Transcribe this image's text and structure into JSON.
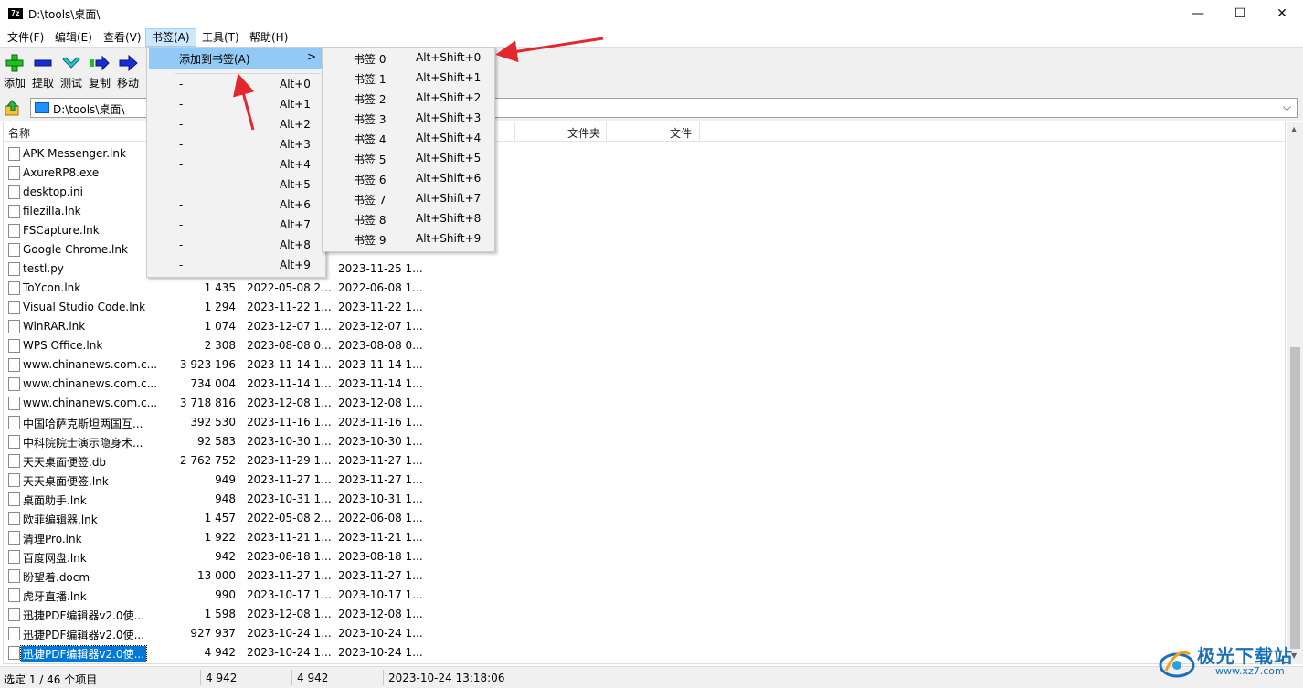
{
  "window": {
    "title": "D:\\tools\\桌面\\",
    "app_icon_text": "7z",
    "minimize": "—",
    "maximize": "☐",
    "close": "✕"
  },
  "menubar": [
    "文件(F)",
    "编辑(E)",
    "查看(V)",
    "书签(A)",
    "工具(T)",
    "帮助(H)"
  ],
  "toolbar": [
    "添加",
    "提取",
    "测试",
    "复制",
    "移动"
  ],
  "address": {
    "path": "D:\\tools\\桌面\\"
  },
  "columns": {
    "name": "名称",
    "folder": "文件夹",
    "file": "文件"
  },
  "files": [
    {
      "name": "APK Messenger.lnk",
      "size": "",
      "modified": "",
      "created": ""
    },
    {
      "name": "AxureRP8.exe",
      "size": "",
      "modified": "",
      "created": ""
    },
    {
      "name": "desktop.ini",
      "size": "",
      "modified": "",
      "created": ""
    },
    {
      "name": "filezilla.lnk",
      "size": "",
      "modified": "",
      "created": ""
    },
    {
      "name": "FSCapture.lnk",
      "size": "",
      "modified": "",
      "created": ""
    },
    {
      "name": "Google Chrome.lnk",
      "size": "",
      "modified": "",
      "created": ""
    },
    {
      "name": "testl.py",
      "size": "",
      "modified": "",
      "created": "2023-11-25 1..."
    },
    {
      "name": "ToYcon.lnk",
      "size": "1 435",
      "modified": "2022-05-08 2...",
      "created": "2022-06-08 1..."
    },
    {
      "name": "Visual Studio Code.lnk",
      "size": "1 294",
      "modified": "2023-11-22 1...",
      "created": "2023-11-22 1..."
    },
    {
      "name": "WinRAR.lnk",
      "size": "1 074",
      "modified": "2023-12-07 1...",
      "created": "2023-12-07 1..."
    },
    {
      "name": "WPS Office.lnk",
      "size": "2 308",
      "modified": "2023-08-08 0...",
      "created": "2023-08-08 0..."
    },
    {
      "name": "www.chinanews.com.c...",
      "size": "3 923 196",
      "modified": "2023-11-14 1...",
      "created": "2023-11-14 1..."
    },
    {
      "name": "www.chinanews.com.c...",
      "size": "734 004",
      "modified": "2023-11-14 1...",
      "created": "2023-11-14 1..."
    },
    {
      "name": "www.chinanews.com.c...",
      "size": "3 718 816",
      "modified": "2023-12-08 1...",
      "created": "2023-12-08 1..."
    },
    {
      "name": "中国哈萨克斯坦两国互...",
      "size": "392 530",
      "modified": "2023-11-16 1...",
      "created": "2023-11-16 1..."
    },
    {
      "name": "中科院院士演示隐身术...",
      "size": "92 583",
      "modified": "2023-10-30 1...",
      "created": "2023-10-30 1..."
    },
    {
      "name": "天天桌面便签.db",
      "size": "2 762 752",
      "modified": "2023-11-29 1...",
      "created": "2023-11-27 1..."
    },
    {
      "name": "天天桌面便签.lnk",
      "size": "949",
      "modified": "2023-11-27 1...",
      "created": "2023-11-27 1..."
    },
    {
      "name": "桌面助手.lnk",
      "size": "948",
      "modified": "2023-10-31 1...",
      "created": "2023-10-31 1..."
    },
    {
      "name": "欧菲编辑器.lnk",
      "size": "1 457",
      "modified": "2022-05-08 2...",
      "created": "2022-06-08 1..."
    },
    {
      "name": "清理Pro.lnk",
      "size": "1 922",
      "modified": "2023-11-21 1...",
      "created": "2023-11-21 1..."
    },
    {
      "name": "百度网盘.lnk",
      "size": "942",
      "modified": "2023-08-18 1...",
      "created": "2023-08-18 1..."
    },
    {
      "name": "盼望着.docm",
      "size": "13 000",
      "modified": "2023-11-27 1...",
      "created": "2023-11-27 1..."
    },
    {
      "name": "虎牙直播.lnk",
      "size": "990",
      "modified": "2023-10-17 1...",
      "created": "2023-10-17 1..."
    },
    {
      "name": "迅捷PDF编辑器v2.0使...",
      "size": "1 598",
      "modified": "2023-12-08 1...",
      "created": "2023-12-08 1..."
    },
    {
      "name": "迅捷PDF编辑器v2.0使...",
      "size": "927 937",
      "modified": "2023-10-24 1...",
      "created": "2023-10-24 1..."
    },
    {
      "name": "迅捷PDF编辑器v2.0使...",
      "size": "4 942",
      "modified": "2023-10-24 1...",
      "created": "2023-10-24 1..."
    }
  ],
  "bookmark_menu": {
    "add_label": "添加到书签(A)",
    "submenu_arrow": ">",
    "items": [
      {
        "label": "-",
        "shortcut": "Alt+0"
      },
      {
        "label": "-",
        "shortcut": "Alt+1"
      },
      {
        "label": "-",
        "shortcut": "Alt+2"
      },
      {
        "label": "-",
        "shortcut": "Alt+3"
      },
      {
        "label": "-",
        "shortcut": "Alt+4"
      },
      {
        "label": "-",
        "shortcut": "Alt+5"
      },
      {
        "label": "-",
        "shortcut": "Alt+6"
      },
      {
        "label": "-",
        "shortcut": "Alt+7"
      },
      {
        "label": "-",
        "shortcut": "Alt+8"
      },
      {
        "label": "-",
        "shortcut": "Alt+9"
      }
    ]
  },
  "add_bookmark_submenu": [
    {
      "label": "书签 0",
      "shortcut": "Alt+Shift+0"
    },
    {
      "label": "书签 1",
      "shortcut": "Alt+Shift+1"
    },
    {
      "label": "书签 2",
      "shortcut": "Alt+Shift+2"
    },
    {
      "label": "书签 3",
      "shortcut": "Alt+Shift+3"
    },
    {
      "label": "书签 4",
      "shortcut": "Alt+Shift+4"
    },
    {
      "label": "书签 5",
      "shortcut": "Alt+Shift+5"
    },
    {
      "label": "书签 6",
      "shortcut": "Alt+Shift+6"
    },
    {
      "label": "书签 7",
      "shortcut": "Alt+Shift+7"
    },
    {
      "label": "书签 8",
      "shortcut": "Alt+Shift+8"
    },
    {
      "label": "书签 9",
      "shortcut": "Alt+Shift+9"
    }
  ],
  "status": {
    "selection": "选定 1 / 46 个项目",
    "size1": "4 942",
    "size2": "4 942",
    "datetime": "2023-10-24 13:18:06"
  },
  "watermark": {
    "name": "极光下载站",
    "url": "www.xz7.com"
  },
  "colors": {
    "menu_highlight": "#91c9f7",
    "selection": "#0078d7",
    "annotation_arrow": "#e0282e"
  }
}
